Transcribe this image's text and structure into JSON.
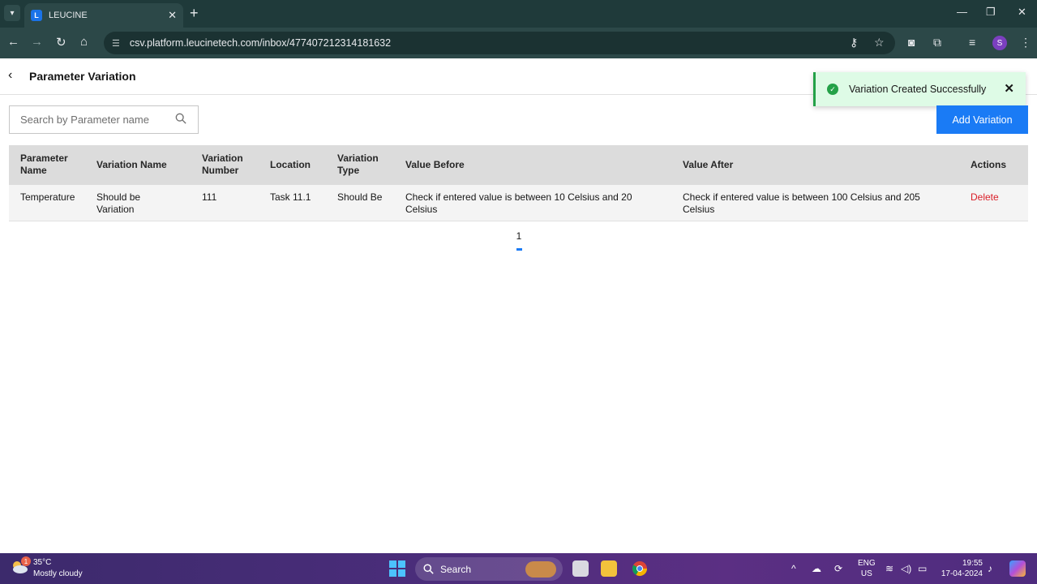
{
  "browser": {
    "tab_title": "LEUCINE",
    "url": "csv.platform.leucinetech.com/inbox/477407212314181632",
    "profile_initial": "S"
  },
  "page": {
    "title": "Parameter Variation"
  },
  "toast": {
    "message": "Variation Created Successfully"
  },
  "search": {
    "placeholder": "Search by Parameter name"
  },
  "add_button_label": "Add Variation",
  "table": {
    "headers": {
      "parameter_name": "Parameter Name",
      "variation_name": "Variation Name",
      "variation_number": "Variation Number",
      "location": "Location",
      "variation_type": "Variation Type",
      "value_before": "Value Before",
      "value_after": "Value After",
      "actions": "Actions"
    },
    "rows": [
      {
        "parameter_name": "Temperature",
        "variation_name": "Should be Variation",
        "variation_number": "111",
        "location": "Task 11.1",
        "variation_type": "Should Be",
        "value_before": "Check if entered value is between 10 Celsius and 20 Celsius",
        "value_after": "Check if entered value is between 100 Celsius and 205 Celsius",
        "action": "Delete"
      }
    ]
  },
  "pagination": {
    "current_page": "1"
  },
  "taskbar": {
    "notification_count": "1",
    "temperature": "35°C",
    "weather": "Mostly cloudy",
    "search_label": "Search",
    "language_line1": "ENG",
    "language_line2": "US",
    "time": "19:55",
    "date": "17-04-2024"
  },
  "colors": {
    "primary": "#1a7bf5",
    "danger": "#da1e28",
    "success": "#24a148",
    "header_bg": "#dcdcdc"
  }
}
